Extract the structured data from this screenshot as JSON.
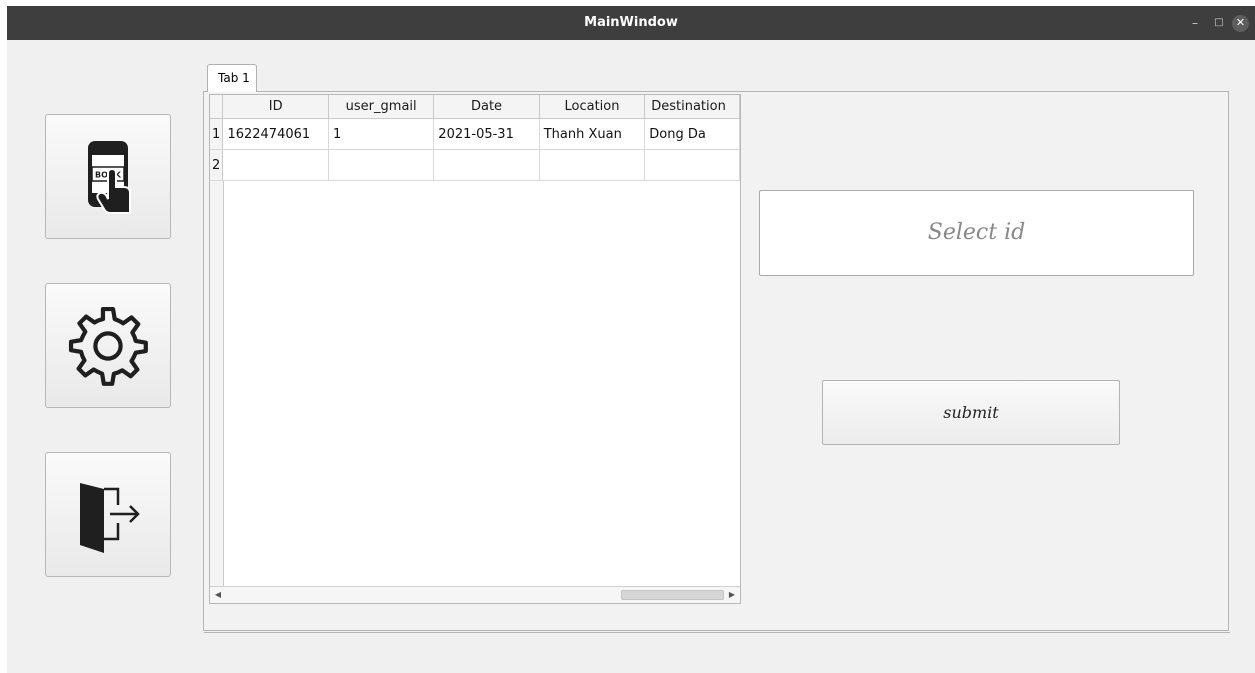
{
  "window": {
    "title": "MainWindow",
    "minimize_glyph": "–",
    "maximize_glyph": "□",
    "close_glyph": "✕"
  },
  "sidebar": {
    "items": [
      {
        "icon": "book-phone-icon",
        "icon_text": "BOOK"
      },
      {
        "icon": "gear-icon"
      },
      {
        "icon": "exit-door-icon"
      }
    ]
  },
  "tabs": [
    {
      "label": "Tab 1"
    }
  ],
  "table": {
    "columns": [
      "ID",
      "user_gmail",
      "Date",
      "Location",
      "Destination"
    ],
    "rows": [
      {
        "num": "1",
        "cells": [
          "1622474061",
          "1",
          "2021-05-31",
          "Thanh Xuan",
          "Dong Da"
        ]
      },
      {
        "num": "2",
        "cells": [
          "",
          "",
          "",
          "",
          ""
        ]
      }
    ]
  },
  "form": {
    "select_placeholder": "Select id",
    "submit_label": "submit"
  }
}
